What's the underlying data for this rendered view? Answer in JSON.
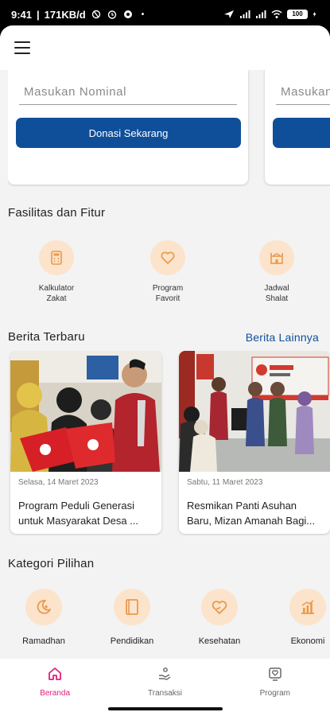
{
  "status_bar": {
    "time": "9:41",
    "net_speed": "171KB/d",
    "dot": "•",
    "battery": "100"
  },
  "donation": {
    "input_placeholder": "Masukan Nominal",
    "button_label": "Donasi Sekarang"
  },
  "features": {
    "title": "Fasilitas dan Fitur",
    "items": [
      {
        "line1": "Kalkulator",
        "line2": "Zakat",
        "icon": "calculator-icon"
      },
      {
        "line1": "Program",
        "line2": "Favorit",
        "icon": "heart-icon"
      },
      {
        "line1": "Jadwal",
        "line2": "Shalat",
        "icon": "mosque-icon"
      }
    ]
  },
  "news": {
    "title": "Berita Terbaru",
    "more_label": "Berita Lainnya",
    "items": [
      {
        "date": "Selasa, 14 Maret 2023",
        "title_line1": "Program Peduli Generasi",
        "title_line2": "untuk Masyarakat Desa ..."
      },
      {
        "date": "Sabtu, 11 Maret 2023",
        "title_line1": "Resmikan Panti Asuhan",
        "title_line2": "Baru, Mizan Amanah Bagi..."
      }
    ]
  },
  "categories": {
    "title": "Kategori Pilihan",
    "items": [
      {
        "label": "Ramadhan",
        "icon": "moon-star-icon"
      },
      {
        "label": "Pendidikan",
        "icon": "book-icon"
      },
      {
        "label": "Kesehatan",
        "icon": "heart-hand-icon"
      },
      {
        "label": "Ekonomi",
        "icon": "chart-icon"
      }
    ]
  },
  "bottom_nav": {
    "items": [
      {
        "label": "Beranda",
        "active": true
      },
      {
        "label": "Transaksi",
        "active": false
      },
      {
        "label": "Program",
        "active": false
      }
    ]
  },
  "colors": {
    "primary_blue": "#0f4f9a",
    "accent_pink": "#e0217a",
    "icon_orange": "#e89a4c",
    "icon_bg": "#fce3cb"
  }
}
